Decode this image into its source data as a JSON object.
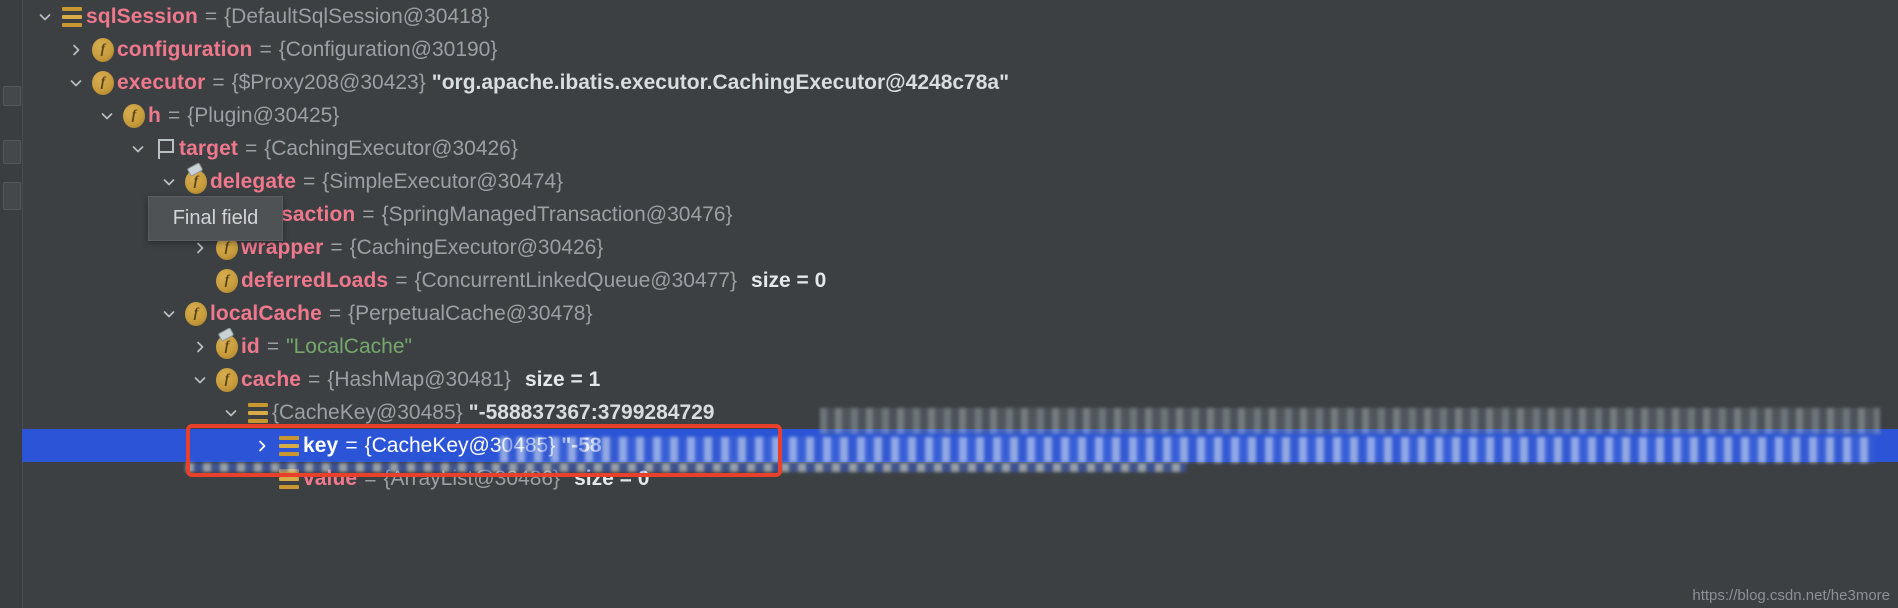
{
  "window": {
    "app": "IntelliJ IDEA Debugger - Variables",
    "background_color": "#3c4043",
    "selection_color": "#2b55d6",
    "name_color": "#f0788c",
    "value_color": "#9aa0a3",
    "string_color": "#77a86b",
    "annotation_color": "#e8402a"
  },
  "tooltip": {
    "text": "Final field",
    "visible": true
  },
  "watermark": {
    "text": "https://blog.csdn.net/he3more"
  },
  "tree": {
    "rows": [
      {
        "id": "sqlSession",
        "indent": 0,
        "toggle": "expanded",
        "icon": "stack-icon",
        "name": "sqlSession",
        "eq": "=",
        "value": "{DefaultSqlSession@30418}",
        "suffix": "",
        "selected": false
      },
      {
        "id": "configuration",
        "indent": 1,
        "toggle": "collapsed",
        "icon": "field-icon",
        "name": "configuration",
        "eq": "=",
        "value": "{Configuration@30190}",
        "suffix": "",
        "selected": false
      },
      {
        "id": "executor",
        "indent": 1,
        "toggle": "expanded",
        "icon": "field-icon",
        "name": "executor",
        "eq": "=",
        "value": "{$Proxy208@30423}",
        "string_value": "\"org.apache.ibatis.executor.CachingExecutor@4248c78a\"",
        "suffix": "",
        "selected": false
      },
      {
        "id": "h",
        "indent": 2,
        "toggle": "expanded",
        "icon": "field-icon",
        "name": "h",
        "eq": "=",
        "value": "{Plugin@30425}",
        "suffix": "",
        "selected": false
      },
      {
        "id": "target",
        "indent": 3,
        "toggle": "expanded",
        "icon": "flag-icon",
        "name": "target",
        "eq": "=",
        "value": "{CachingExecutor@30426}",
        "suffix": "",
        "selected": false
      },
      {
        "id": "delegate",
        "indent": 4,
        "toggle": "expanded",
        "icon": "final-field-icon",
        "name": "delegate",
        "eq": "=",
        "value": "{SimpleExecutor@30474}",
        "suffix": "",
        "selected": false
      },
      {
        "id": "transaction",
        "indent": 5,
        "toggle": "none",
        "icon": "final-field-icon",
        "name": "transaction",
        "eq": "=",
        "value": "{SpringManagedTransaction@30476}",
        "suffix": "",
        "selected": false
      },
      {
        "id": "wrapper",
        "indent": 5,
        "toggle": "collapsed",
        "icon": "field-icon",
        "name": "wrapper",
        "eq": "=",
        "value": "{CachingExecutor@30426}",
        "suffix": "",
        "selected": false
      },
      {
        "id": "deferredLoads",
        "indent": 5,
        "toggle": "none",
        "icon": "field-icon",
        "name": "deferredLoads",
        "eq": "=",
        "value": "{ConcurrentLinkedQueue@30477}",
        "suffix": "size = 0",
        "selected": false
      },
      {
        "id": "localCache",
        "indent": 4,
        "toggle": "expanded",
        "icon": "field-icon",
        "name": "localCache",
        "eq": "=",
        "value": "{PerpetualCache@30478}",
        "suffix": "",
        "selected": false
      },
      {
        "id": "id",
        "indent": 5,
        "toggle": "collapsed",
        "icon": "final-field-icon",
        "name": "id",
        "eq": "=",
        "string_literal": "\"LocalCache\"",
        "value": "",
        "suffix": "",
        "selected": false
      },
      {
        "id": "cache",
        "indent": 5,
        "toggle": "expanded",
        "icon": "field-icon",
        "name": "cache",
        "eq": "=",
        "value": "{HashMap@30481}",
        "suffix": "size = 1",
        "selected": false
      },
      {
        "id": "cacheKeyEntry",
        "indent": 6,
        "toggle": "expanded",
        "icon": "stack-icon",
        "name": "",
        "eq": "",
        "value": "{CacheKey@30485}",
        "string_value": "\"-588837367:3799284729",
        "suffix": "",
        "selected": false,
        "redacted": true
      },
      {
        "id": "key",
        "indent": 7,
        "toggle": "collapsed",
        "icon": "stack-icon",
        "name": "key",
        "eq": "=",
        "value": "{CacheKey@30485}",
        "string_value": "\"-58",
        "suffix": "",
        "selected": true,
        "redacted": true,
        "annotated": true
      },
      {
        "id": "value",
        "indent": 7,
        "toggle": "none",
        "icon": "stack-icon",
        "name": "value",
        "eq": "=",
        "value": "{ArrayList@30486}",
        "suffix": "size = 0",
        "selected": false
      }
    ]
  }
}
